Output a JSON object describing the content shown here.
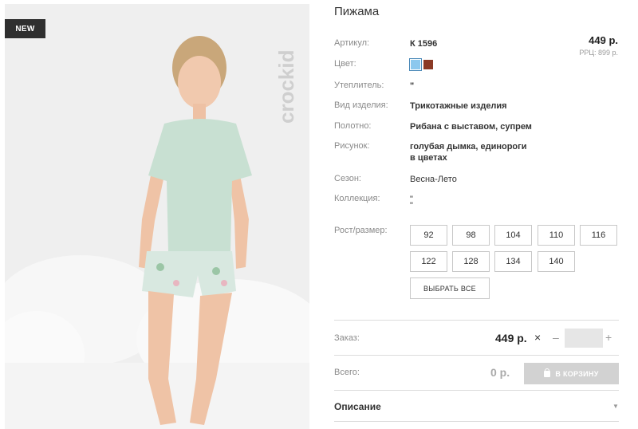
{
  "badge": "NEW",
  "brand": "crockid",
  "title": "Пижама",
  "price": "449 р.",
  "rrp": "РРЦ: 899 р.",
  "colors": [
    "#8cc8ee",
    "#8b3a26"
  ],
  "fields": [
    {
      "label": "Артикул:",
      "value": "К 1596"
    },
    {
      "label": "Цвет:",
      "value": ""
    },
    {
      "label": "Утеплитель:",
      "value": "\""
    },
    {
      "label": "Вид изделия:",
      "value": "Трикотажные изделия"
    },
    {
      "label": "Полотно:",
      "value": "Рибана с выставом, супрем"
    },
    {
      "label": "Рисунок:",
      "value": "голубая дымка, единороги",
      "value2": "в цветах"
    },
    {
      "label": "Сезон:",
      "value": "Весна-Лето"
    },
    {
      "label": "Коллекция:",
      "value": "\"",
      "value2": "\""
    },
    {
      "label": "Рост/размер:",
      "value": ""
    }
  ],
  "sizes": [
    "92",
    "98",
    "104",
    "110",
    "116",
    "122",
    "128",
    "134",
    "140"
  ],
  "select_all": "ВЫБРАТЬ ВСЕ",
  "order": {
    "label": "Заказ:",
    "price": "449 р.",
    "times": "×",
    "minus": "–",
    "plus": "+"
  },
  "total": {
    "label": "Всего:",
    "value": "0 р.",
    "cart_button": "В КОРЗИНУ"
  },
  "description": "Описание"
}
